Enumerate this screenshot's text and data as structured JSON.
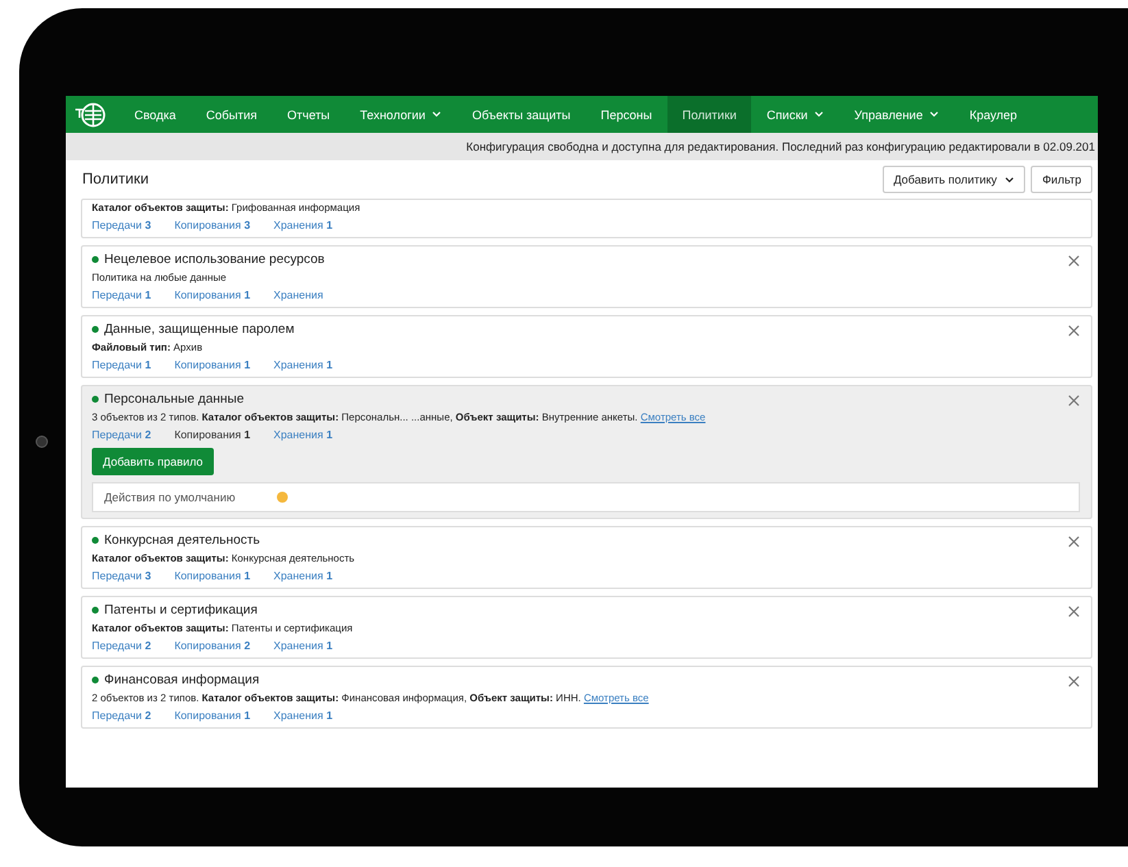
{
  "nav": {
    "items": [
      {
        "label": "Сводка",
        "selected": false,
        "dropdown": false
      },
      {
        "label": "События",
        "selected": false,
        "dropdown": false
      },
      {
        "label": "Отчеты",
        "selected": false,
        "dropdown": false
      },
      {
        "label": "Технологии",
        "selected": false,
        "dropdown": true
      },
      {
        "label": "Объекты защиты",
        "selected": false,
        "dropdown": false
      },
      {
        "label": "Персоны",
        "selected": false,
        "dropdown": false
      },
      {
        "label": "Политики",
        "selected": true,
        "dropdown": false
      },
      {
        "label": "Списки",
        "selected": false,
        "dropdown": true
      },
      {
        "label": "Управление",
        "selected": false,
        "dropdown": true
      },
      {
        "label": "Краулер",
        "selected": false,
        "dropdown": false
      }
    ]
  },
  "notice": "Конфигурация свободна и доступна для редактирования. Последний раз конфигурацию редактировали в 02.09.201",
  "header": {
    "title": "Политики",
    "buttons": [
      {
        "label": "Добавить политику",
        "dropdown": true
      },
      {
        "label": "Фильтр",
        "dropdown": false
      }
    ]
  },
  "policies": [
    {
      "details": "**Каталог объектов защиты:** Грифованная информация",
      "expanded": false,
      "stats": [
        {
          "label": "Передачи",
          "count": "3",
          "selected": false
        },
        {
          "label": "Копирования",
          "count": "3",
          "selected": false
        },
        {
          "label": "Хранения",
          "count": "1",
          "selected": false
        }
      ]
    },
    {
      "title": "Нецелевое использование ресурсов",
      "details": "Политика на любые данные",
      "expanded": false,
      "stats": [
        {
          "label": "Передачи",
          "count": "1",
          "selected": false
        },
        {
          "label": "Копирования",
          "count": "1",
          "selected": false
        },
        {
          "label": "Хранения",
          "selected": false
        }
      ]
    },
    {
      "title": "Данные, защищенные паролем",
      "details": "**Файловый тип:** Архив",
      "expanded": false,
      "stats": [
        {
          "label": "Передачи",
          "count": "1",
          "selected": false
        },
        {
          "label": "Копирования",
          "count": "1",
          "selected": false
        },
        {
          "label": "Хранения",
          "count": "1",
          "selected": false
        }
      ]
    },
    {
      "title": "Персональные данные",
      "details": "3 объектов из 2 типов. **Каталог объектов защиты:** Персональн... ...анные, **Объект защиты:** Внутренние анкеты.",
      "link": "Смотреть все",
      "expanded": true,
      "stats": [
        {
          "label": "Передачи",
          "count": "2",
          "selected": false
        },
        {
          "label": "Копирования",
          "count": "1",
          "selected": true
        },
        {
          "label": "Хранения",
          "count": "1",
          "selected": false
        }
      ],
      "add_rule": "Добавить правило",
      "default_action": {
        "label": "Действия по умолчанию",
        "color": "#f5b83d"
      }
    },
    {
      "title": "Конкурсная деятельность",
      "details": "**Каталог объектов защиты:** Конкурсная деятельность",
      "expanded": false,
      "stats": [
        {
          "label": "Передачи",
          "count": "3",
          "selected": false
        },
        {
          "label": "Копирования",
          "count": "1",
          "selected": false
        },
        {
          "label": "Хранения",
          "count": "1",
          "selected": false
        }
      ]
    },
    {
      "title": "Патенты и сертификация",
      "details": "**Каталог объектов защиты:** Патенты и сертификация",
      "expanded": false,
      "stats": [
        {
          "label": "Передачи",
          "count": "2",
          "selected": false
        },
        {
          "label": "Копирования",
          "count": "2",
          "selected": false
        },
        {
          "label": "Хранения",
          "count": "1",
          "selected": false
        }
      ]
    },
    {
      "title": "Финансовая информация",
      "details": "2 объектов из 2 типов. **Каталог объектов защиты:** Финансовая информация, **Объект защиты:** ИНН.",
      "link": "Смотреть все",
      "expanded": false,
      "stats": [
        {
          "label": "Передачи",
          "count": "2",
          "selected": false
        },
        {
          "label": "Копирования",
          "count": "1",
          "selected": false
        },
        {
          "label": "Хранения",
          "count": "1",
          "selected": false
        }
      ]
    }
  ]
}
